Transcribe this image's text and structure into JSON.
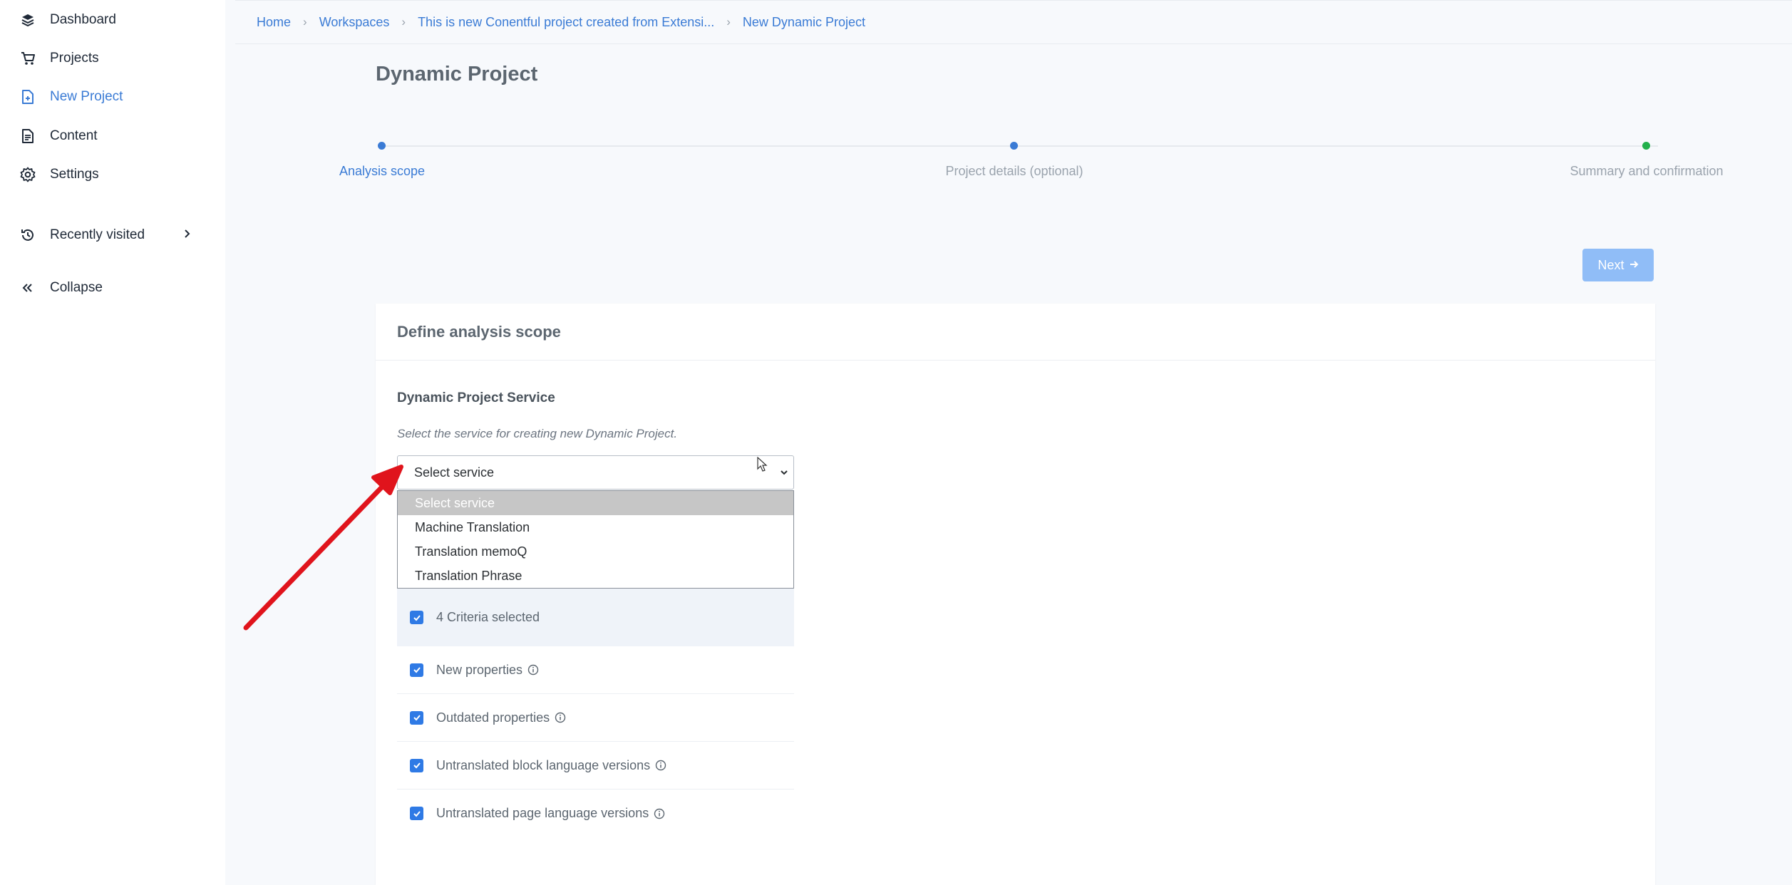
{
  "sidebar": {
    "items": [
      {
        "label": "Dashboard",
        "icon": "layers-icon"
      },
      {
        "label": "Projects",
        "icon": "cart-icon"
      },
      {
        "label": "New Project",
        "icon": "new-file-icon",
        "active": true
      },
      {
        "label": "Content",
        "icon": "document-icon"
      },
      {
        "label": "Settings",
        "icon": "gear-icon"
      }
    ],
    "recent": {
      "label": "Recently visited",
      "icon": "history-icon"
    },
    "collapse": {
      "label": "Collapse",
      "icon": "double-chevron-left-icon"
    }
  },
  "breadcrumb": [
    "Home",
    "Workspaces",
    "This is new Conentful project created from Extensi...",
    "New Dynamic Project"
  ],
  "page": {
    "title": "Dynamic Project"
  },
  "stepper": {
    "steps": [
      {
        "label": "Analysis scope",
        "state": "active",
        "color": "#3a7bd5"
      },
      {
        "label": "Project details (optional)",
        "state": "pending",
        "color": "#3a7bd5"
      },
      {
        "label": "Summary and confirmation",
        "state": "pending",
        "color": "#22b04b"
      }
    ]
  },
  "next_button": {
    "label": "Next"
  },
  "card": {
    "title": "Define analysis scope",
    "section_title": "Dynamic Project Service",
    "section_desc": "Select the service for creating new Dynamic Project.",
    "select": {
      "value": "Select service",
      "options": [
        "Select service",
        "Machine Translation",
        "Translation memoQ",
        "Translation Phrase"
      ]
    },
    "criteria": {
      "summary": "4 Criteria selected",
      "items": [
        "New properties",
        "Outdated properties",
        "Untranslated block language versions",
        "Untranslated page language versions"
      ]
    }
  },
  "colors": {
    "accent": "#3a7bd5",
    "arrow": "#e0141c",
    "checkbox": "#2f7ae5",
    "success": "#22b04b"
  }
}
